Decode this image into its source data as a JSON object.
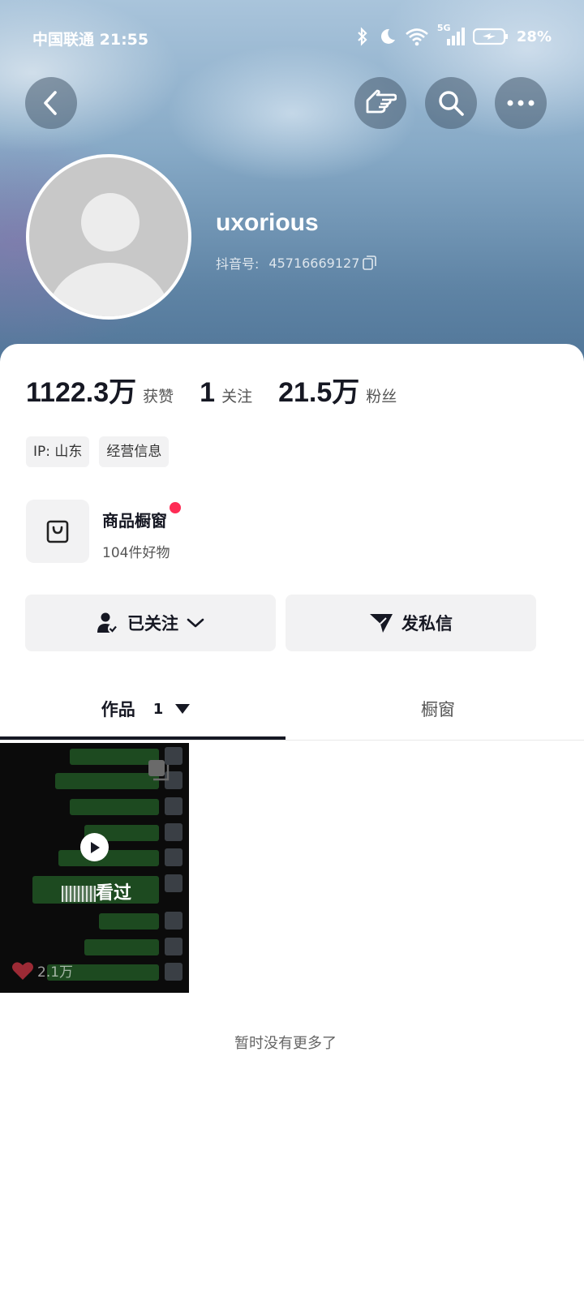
{
  "status_bar": {
    "carrier": "中国联通",
    "time": "21:55",
    "battery": "28%",
    "network": "5G"
  },
  "profile": {
    "nickname": "uxorious",
    "id_label": "抖音号:",
    "id_value": "45716669127"
  },
  "stats": [
    {
      "value": "1122.3万",
      "label": "获赞"
    },
    {
      "value": "1",
      "label": "关注"
    },
    {
      "value": "21.5万",
      "label": "粉丝"
    }
  ],
  "tags": [
    "IP:  山东",
    "经营信息"
  ],
  "shop": {
    "title": "商品橱窗",
    "subtitle": "104件好物"
  },
  "actions": {
    "follow_label": "已关注",
    "message_label": "发私信"
  },
  "tabs": {
    "works": "作品",
    "works_count": "1",
    "showcase": "橱窗"
  },
  "video": {
    "overlay_text": "看过",
    "likes": "2.1万"
  },
  "footer": {
    "no_more": "暂时没有更多了"
  },
  "colors": {
    "accent_red": "#fe2c55",
    "text_primary": "#161823"
  }
}
